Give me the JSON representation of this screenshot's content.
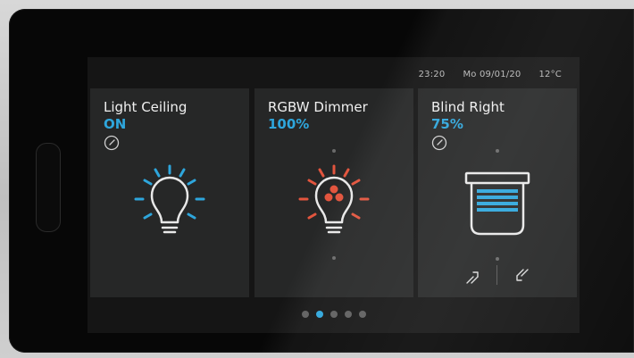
{
  "status": {
    "time": "23:20",
    "date": "Mo 09/01/20",
    "temperature": "12°C"
  },
  "tiles": [
    {
      "title": "Light Ceiling",
      "value": "ON",
      "icon": "lightbulb-icon",
      "color": "#2ea6dc"
    },
    {
      "title": "RGBW Dimmer",
      "value": "100%",
      "icon": "rgb-lightbulb-icon",
      "color": "#e2553e"
    },
    {
      "title": "Blind Right",
      "value": "75%",
      "icon": "blind-icon",
      "color": "#2ea6dc"
    }
  ],
  "pager": {
    "count": 5,
    "active_index": 1
  },
  "colors": {
    "accent": "#2ea6dc",
    "rgb": "#e2553e",
    "tile_bg": "#262727",
    "screen_bg": "#151515"
  }
}
